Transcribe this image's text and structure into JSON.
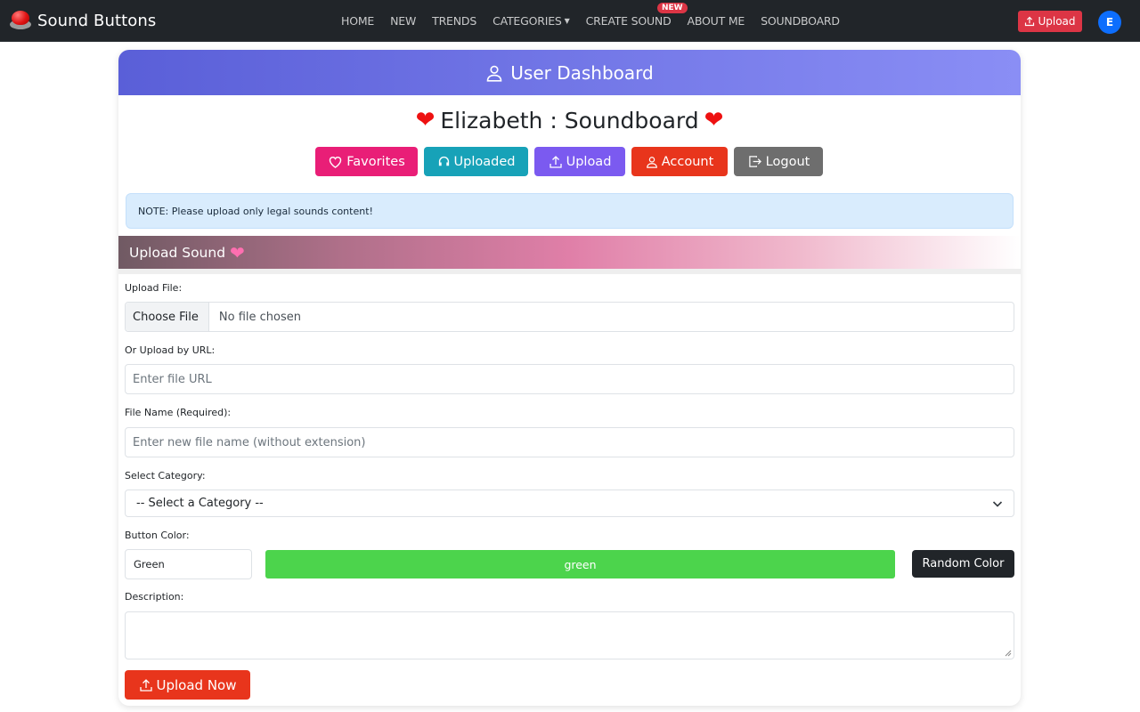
{
  "brand": {
    "name": "Sound Buttons"
  },
  "nav": {
    "items": [
      {
        "label": "HOME"
      },
      {
        "label": "NEW"
      },
      {
        "label": "TRENDS"
      },
      {
        "label": "CATEGORIES"
      },
      {
        "label": "CREATE SOUND"
      },
      {
        "label": "ABOUT ME"
      },
      {
        "label": "SOUNDBOARD"
      }
    ],
    "new_badge": "NEW",
    "upload_label": "Upload",
    "avatar_initial": "E"
  },
  "dashboard": {
    "header": "User Dashboard",
    "title": "Elizabeth : Soundboard",
    "buttons": {
      "favorites": "Favorites",
      "uploaded": "Uploaded",
      "upload": "Upload",
      "account": "Account",
      "logout": "Logout"
    },
    "note": "NOTE: Please upload only legal sounds content!"
  },
  "upload_form": {
    "section_title": "Upload Sound",
    "file_label": "Upload File:",
    "file_button": "Choose File",
    "file_status": "No file chosen",
    "url_label": "Or Upload by URL:",
    "url_placeholder": "Enter file URL",
    "name_label": "File Name (Required):",
    "name_placeholder": "Enter new file name (without extension)",
    "category_label": "Select Category:",
    "category_value": "-- Select a Category --",
    "color_label": "Button Color:",
    "color_value": "Green",
    "color_preview": "green",
    "random_color": "Random Color",
    "description_label": "Description:",
    "submit": "Upload Now"
  },
  "colors": {
    "navbar": "#212529",
    "header_gradient_start": "#5a5fd8",
    "header_gradient_end": "#8a8ef5",
    "favorites": "#e91e77",
    "uploaded": "#17a2b8",
    "upload": "#7b5af0",
    "account": "#e8351c",
    "logout": "#6e6e6e",
    "button_color_preview": "#4cd44c"
  }
}
